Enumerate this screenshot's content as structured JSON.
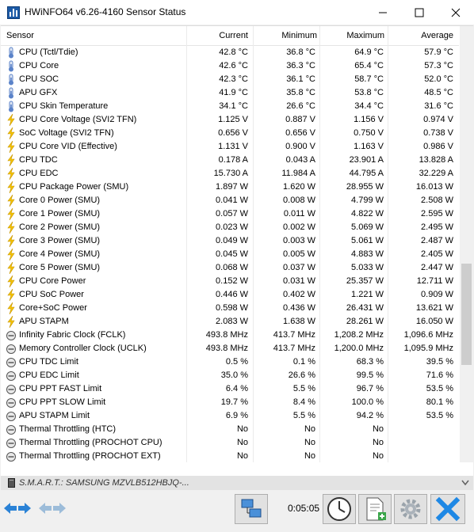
{
  "window": {
    "title": "HWiNFO64 v6.26-4160 Sensor Status"
  },
  "header": {
    "sensor": "Sensor",
    "current": "Current",
    "minimum": "Minimum",
    "maximum": "Maximum",
    "average": "Average"
  },
  "rows": [
    {
      "icon": "thermometer",
      "name": "CPU (Tctl/Tdie)",
      "cur": "42.8 °C",
      "min": "36.8 °C",
      "max": "64.9 °C",
      "avg": "57.9 °C"
    },
    {
      "icon": "thermometer",
      "name": "CPU Core",
      "cur": "42.6 °C",
      "min": "36.3 °C",
      "max": "65.4 °C",
      "avg": "57.3 °C"
    },
    {
      "icon": "thermometer",
      "name": "CPU SOC",
      "cur": "42.3 °C",
      "min": "36.1 °C",
      "max": "58.7 °C",
      "avg": "52.0 °C"
    },
    {
      "icon": "thermometer",
      "name": "APU GFX",
      "cur": "41.9 °C",
      "min": "35.8 °C",
      "max": "53.8 °C",
      "avg": "48.5 °C"
    },
    {
      "icon": "thermometer",
      "name": "CPU Skin Temperature",
      "cur": "34.1 °C",
      "min": "26.6 °C",
      "max": "34.4 °C",
      "avg": "31.6 °C"
    },
    {
      "icon": "bolt",
      "name": "CPU Core Voltage (SVI2 TFN)",
      "cur": "1.125 V",
      "min": "0.887 V",
      "max": "1.156 V",
      "avg": "0.974 V"
    },
    {
      "icon": "bolt",
      "name": "SoC Voltage (SVI2 TFN)",
      "cur": "0.656 V",
      "min": "0.656 V",
      "max": "0.750 V",
      "avg": "0.738 V"
    },
    {
      "icon": "bolt",
      "name": "CPU Core VID (Effective)",
      "cur": "1.131 V",
      "min": "0.900 V",
      "max": "1.163 V",
      "avg": "0.986 V"
    },
    {
      "icon": "bolt",
      "name": "CPU TDC",
      "cur": "0.178 A",
      "min": "0.043 A",
      "max": "23.901 A",
      "avg": "13.828 A"
    },
    {
      "icon": "bolt",
      "name": "CPU EDC",
      "cur": "15.730 A",
      "min": "11.984 A",
      "max": "44.795 A",
      "avg": "32.229 A"
    },
    {
      "icon": "bolt",
      "name": "CPU Package Power (SMU)",
      "cur": "1.897 W",
      "min": "1.620 W",
      "max": "28.955 W",
      "avg": "16.013 W"
    },
    {
      "icon": "bolt",
      "name": "Core 0 Power (SMU)",
      "cur": "0.041 W",
      "min": "0.008 W",
      "max": "4.799 W",
      "avg": "2.508 W"
    },
    {
      "icon": "bolt",
      "name": "Core 1 Power (SMU)",
      "cur": "0.057 W",
      "min": "0.011 W",
      "max": "4.822 W",
      "avg": "2.595 W"
    },
    {
      "icon": "bolt",
      "name": "Core 2 Power (SMU)",
      "cur": "0.023 W",
      "min": "0.002 W",
      "max": "5.069 W",
      "avg": "2.495 W"
    },
    {
      "icon": "bolt",
      "name": "Core 3 Power (SMU)",
      "cur": "0.049 W",
      "min": "0.003 W",
      "max": "5.061 W",
      "avg": "2.487 W"
    },
    {
      "icon": "bolt",
      "name": "Core 4 Power (SMU)",
      "cur": "0.045 W",
      "min": "0.005 W",
      "max": "4.883 W",
      "avg": "2.405 W"
    },
    {
      "icon": "bolt",
      "name": "Core 5 Power (SMU)",
      "cur": "0.068 W",
      "min": "0.037 W",
      "max": "5.033 W",
      "avg": "2.447 W"
    },
    {
      "icon": "bolt",
      "name": "CPU Core Power",
      "cur": "0.152 W",
      "min": "0.031 W",
      "max": "25.357 W",
      "avg": "12.711 W"
    },
    {
      "icon": "bolt",
      "name": "CPU SoC Power",
      "cur": "0.446 W",
      "min": "0.402 W",
      "max": "1.221 W",
      "avg": "0.909 W"
    },
    {
      "icon": "bolt",
      "name": "Core+SoC Power",
      "cur": "0.598 W",
      "min": "0.436 W",
      "max": "26.431 W",
      "avg": "13.621 W"
    },
    {
      "icon": "bolt",
      "name": "APU STAPM",
      "cur": "2.083 W",
      "min": "1.638 W",
      "max": "28.261 W",
      "avg": "16.050 W"
    },
    {
      "icon": "gauge",
      "name": "Infinity Fabric Clock (FCLK)",
      "cur": "493.8 MHz",
      "min": "413.7 MHz",
      "max": "1,208.2 MHz",
      "avg": "1,096.6 MHz"
    },
    {
      "icon": "gauge",
      "name": "Memory Controller Clock (UCLK)",
      "cur": "493.8 MHz",
      "min": "413.7 MHz",
      "max": "1,200.0 MHz",
      "avg": "1,095.9 MHz"
    },
    {
      "icon": "gauge",
      "name": "CPU TDC Limit",
      "cur": "0.5 %",
      "min": "0.1 %",
      "max": "68.3 %",
      "avg": "39.5 %"
    },
    {
      "icon": "gauge",
      "name": "CPU EDC Limit",
      "cur": "35.0 %",
      "min": "26.6 %",
      "max": "99.5 %",
      "avg": "71.6 %"
    },
    {
      "icon": "gauge",
      "name": "CPU PPT FAST Limit",
      "cur": "6.4 %",
      "min": "5.5 %",
      "max": "96.7 %",
      "avg": "53.5 %"
    },
    {
      "icon": "gauge",
      "name": "CPU PPT SLOW Limit",
      "cur": "19.7 %",
      "min": "8.4 %",
      "max": "100.0 %",
      "avg": "80.1 %"
    },
    {
      "icon": "gauge",
      "name": "APU STAPM Limit",
      "cur": "6.9 %",
      "min": "5.5 %",
      "max": "94.2 %",
      "avg": "53.5 %"
    },
    {
      "icon": "gauge",
      "name": "Thermal Throttling (HTC)",
      "cur": "No",
      "min": "No",
      "max": "No",
      "avg": ""
    },
    {
      "icon": "gauge",
      "name": "Thermal Throttling (PROCHOT CPU)",
      "cur": "No",
      "min": "No",
      "max": "No",
      "avg": ""
    },
    {
      "icon": "gauge",
      "name": "Thermal Throttling (PROCHOT EXT)",
      "cur": "No",
      "min": "No",
      "max": "No",
      "avg": ""
    }
  ],
  "smart": {
    "label": "S.M.A.R.T.: SAMSUNG MZVLB512HBJQ-..."
  },
  "toolbar": {
    "timer": "0:05:05"
  },
  "colors": {
    "bolt": "#f5c400",
    "thermo": "#5b83c9",
    "close_x": "#1e88e5"
  }
}
